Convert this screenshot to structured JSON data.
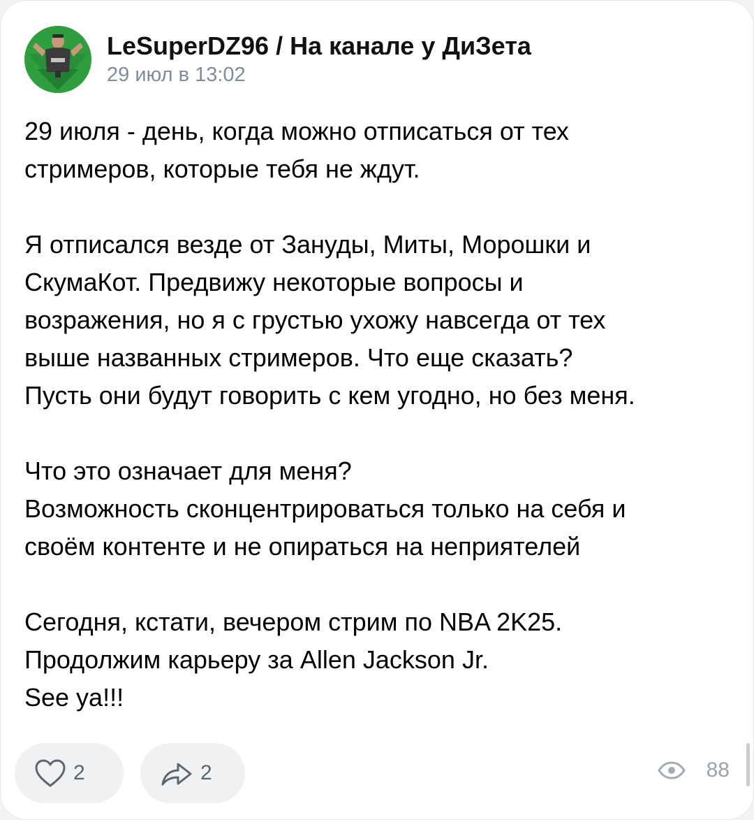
{
  "post": {
    "author": "LeSuperDZ96 / На канале у ДиЗета",
    "timestamp": "29 июл в 13:02",
    "paragraphs": [
      [
        "29 июля - день, когда можно отписаться от тех",
        "стримеров, которые тебя не ждут."
      ],
      [
        "Я отписался везде от Зануды, Миты, Морошки и",
        "СкумаКот. Предвижу некоторые вопросы и",
        "возражения, но я с грустью ухожу навсегда от тех",
        "выше названных стримеров. Что еще сказать?",
        "Пусть они будут говорить с кем угодно, но без меня."
      ],
      [
        "Что это означает для меня?",
        "Возможность сконцентрироваться только на себя и",
        "своём контенте и не опираться на неприятелей"
      ],
      [
        "Сегодня, кстати, вечером стрим по NBA 2K25.",
        "Продолжим карьеру за Allen Jackson Jr.",
        "See ya!!!"
      ]
    ]
  },
  "actions": {
    "likes": "2",
    "shares": "2",
    "views": "88"
  },
  "icons": {
    "like": "heart-icon",
    "share": "share-arrow-icon",
    "views": "eye-icon"
  },
  "colors": {
    "avatar_bg": "#2f9e3f",
    "muted_text": "#818c99",
    "pill_bg": "#f0f1f3"
  }
}
